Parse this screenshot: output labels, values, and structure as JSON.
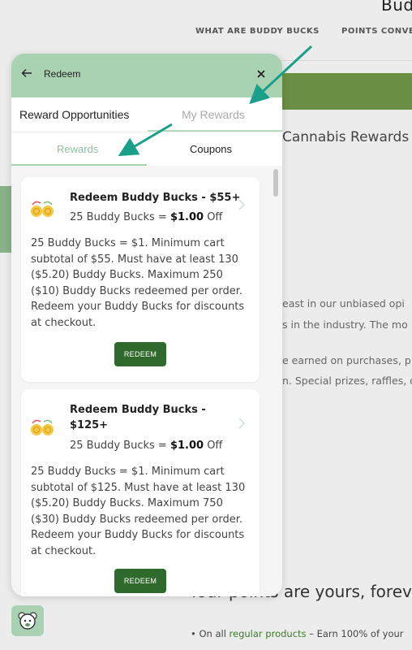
{
  "background": {
    "title": "Bud",
    "nav": [
      "WHAT ARE BUDDY BUCKS",
      "POINTS CONVE"
    ],
    "heading": "Cannabis Rewards I",
    "text_lines": [
      "east in our unbiased opi",
      "s in the industry. The mo",
      "e earned on purchases, p",
      "n. Special prizes, raffles, d"
    ],
    "subheading": "Your points are yours, foreve",
    "bullet_prefix": "On all",
    "bullet_link": "regular products",
    "bullet_suffix": "– Earn 100% of your"
  },
  "header": {
    "back_icon": "arrow-left-icon",
    "title": "Redeem",
    "close_icon": "close-icon"
  },
  "top_tabs": {
    "reward_opportunities": "Reward Opportunities",
    "my_rewards": "My Rewards",
    "active": "my_rewards"
  },
  "sub_tabs": {
    "rewards": "Rewards",
    "coupons": "Coupons",
    "active": "rewards"
  },
  "rewards": [
    {
      "title": "Redeem Buddy Bucks - $55+",
      "rate_prefix": "25 Buddy Bucks = ",
      "rate_value": "$1.00",
      "rate_suffix": " Off",
      "description": "25 Buddy Bucks = $1. Minimum cart subtotal of $55. Must have at least 130 ($5.20) Buddy Bucks. Maximum 250 ($10) Buddy Bucks redeemed per order. Redeem your Buddy Bucks for discounts at checkout.",
      "button": "REDEEM",
      "icon": "coins-icon"
    },
    {
      "title": "Redeem Buddy Bucks - $125+",
      "rate_prefix": "25 Buddy Bucks = ",
      "rate_value": "$1.00",
      "rate_suffix": " Off",
      "description": "25 Buddy Bucks = $1. Minimum cart subtotal of $125. Must have at least 130 ($5.20) Buddy Bucks. Maximum 750 ($30) Buddy Bucks redeemed per order. Redeem your Buddy Bucks for discounts at checkout.",
      "button": "REDEEM",
      "icon": "coins-icon"
    }
  ],
  "colors": {
    "header_bg": "#a9d2b3",
    "button_bg": "#2f6a2c",
    "annotation_arrow": "#1aa08a"
  }
}
